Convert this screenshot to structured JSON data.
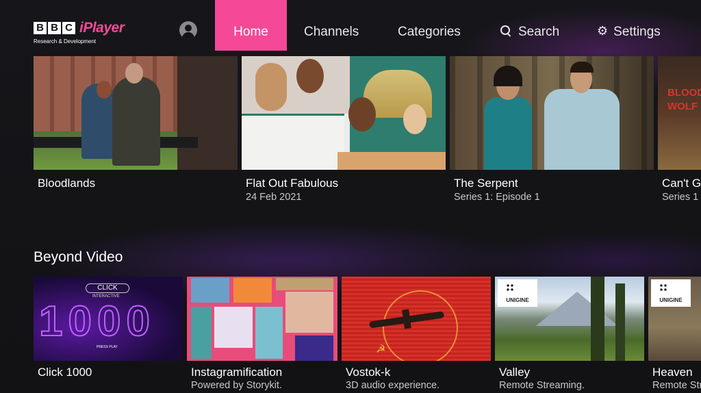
{
  "brand": {
    "logo_letters": [
      "B",
      "B",
      "C"
    ],
    "product": "iPlayer",
    "subtitle": "Research & Development",
    "accent": "#f54997"
  },
  "nav": {
    "profile_icon": "account-icon",
    "items": [
      {
        "label": "Home",
        "active": true
      },
      {
        "label": "Channels",
        "active": false
      },
      {
        "label": "Categories",
        "active": false
      },
      {
        "label": "Search",
        "icon": "search-icon",
        "active": false
      },
      {
        "label": "Settings",
        "icon": "gear-icon",
        "active": false
      }
    ]
  },
  "featured": [
    {
      "title": "Bloodlands",
      "subtitle": ""
    },
    {
      "title": "Flat Out Fabulous",
      "subtitle": "24 Feb 2021"
    },
    {
      "title": "The Serpent",
      "subtitle": "Series 1: Episode 1"
    },
    {
      "title": "Can't G",
      "subtitle": "Series 1",
      "art_text": "BLOOD WOLF"
    }
  ],
  "beyond_video": {
    "heading": "Beyond Video",
    "items": [
      {
        "title": "Click 1000",
        "subtitle": "",
        "art_text": "CLICK",
        "art_big": "1000",
        "art_tag": "INTERACTIVE",
        "art_small": "PRESS PLAY"
      },
      {
        "title": "Instagramification",
        "subtitle": "Powered by Storykit."
      },
      {
        "title": "Vostok-k",
        "subtitle": "3D audio experience.",
        "art_symbol": "☭"
      },
      {
        "title": "Valley",
        "subtitle": "Remote Streaming.",
        "badge": "UNIGINE"
      },
      {
        "title": "Heaven",
        "subtitle": "Remote Str",
        "badge": "UNIGINE"
      }
    ]
  }
}
